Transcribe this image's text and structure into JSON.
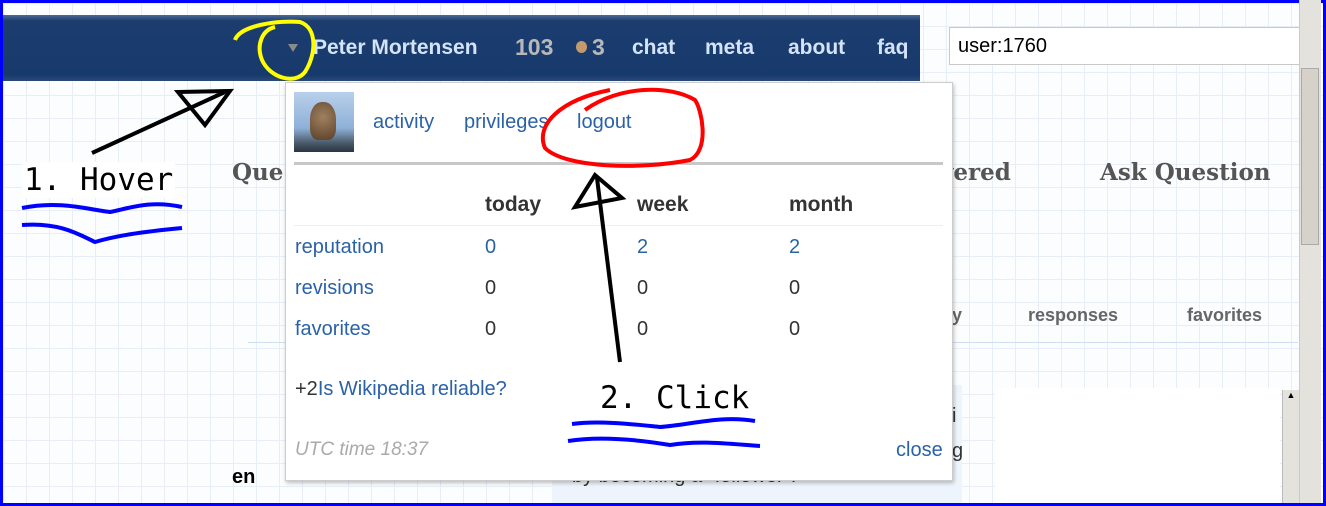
{
  "header": {
    "username": "Peter Mortensen",
    "reputation": "103",
    "badge_count": "3",
    "nav": [
      "chat",
      "meta",
      "about",
      "faq"
    ]
  },
  "search": {
    "value": "user:1760"
  },
  "background": {
    "title_fragment": "Que",
    "tab_fragment": "vered",
    "ask_question": "Ask Question",
    "subtab_fragment": "ty",
    "subtabs": [
      "responses",
      "favorites"
    ],
    "text_fragment_left": "en",
    "text_fragment_mid": "by becoming a \"follower\".",
    "text_fragment_right_1": "i",
    "text_fragment_right_2": "g"
  },
  "popup": {
    "links": [
      "activity",
      "privileges",
      "logout"
    ],
    "columns": [
      "today",
      "week",
      "month"
    ],
    "rows": [
      {
        "label": "reputation",
        "values": [
          "0",
          "2",
          "2"
        ],
        "linked": true
      },
      {
        "label": "revisions",
        "values": [
          "0",
          "0",
          "0"
        ],
        "linked": false
      },
      {
        "label": "favorites",
        "values": [
          "0",
          "0",
          "0"
        ],
        "linked": false
      }
    ],
    "recent_delta": "+2",
    "recent_question": "Is Wikipedia reliable?",
    "utc_time": "UTC time 18:37",
    "close": "close"
  },
  "annotations": {
    "step1": "1. Hover",
    "step2": "2. Click"
  },
  "colors": {
    "header": "#173a6c",
    "link": "#2a62a8",
    "annotation_blue": "#0000ff",
    "annotation_red": "#ff0000",
    "annotation_yellow": "#ffff00"
  }
}
